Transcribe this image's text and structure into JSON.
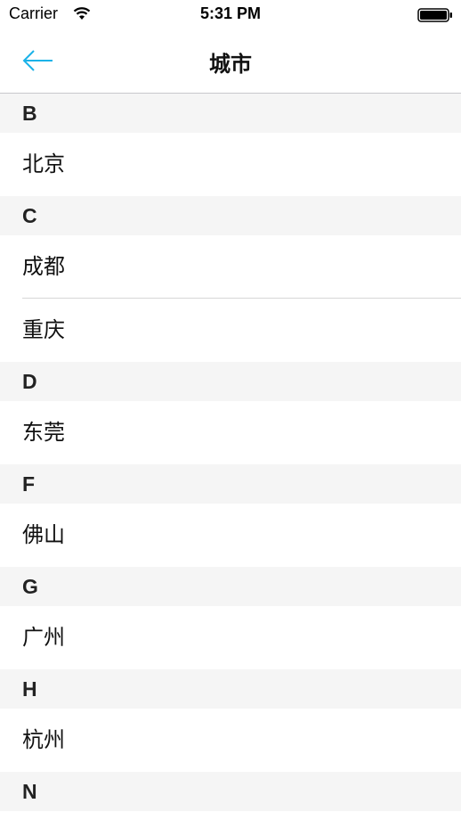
{
  "status_bar": {
    "carrier": "Carrier",
    "time": "5:31 PM"
  },
  "nav": {
    "title": "城市",
    "back_icon": "arrow-left-icon",
    "accent_color": "#1ab2e8"
  },
  "sections": [
    {
      "letter": "B",
      "cities": [
        "北京"
      ]
    },
    {
      "letter": "C",
      "cities": [
        "成都",
        "重庆"
      ]
    },
    {
      "letter": "D",
      "cities": [
        "东莞"
      ]
    },
    {
      "letter": "F",
      "cities": [
        "佛山"
      ]
    },
    {
      "letter": "G",
      "cities": [
        "广州"
      ]
    },
    {
      "letter": "H",
      "cities": [
        "杭州"
      ]
    },
    {
      "letter": "N",
      "cities": []
    }
  ]
}
